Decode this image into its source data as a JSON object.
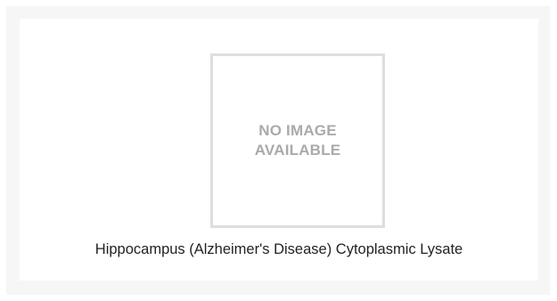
{
  "product": {
    "image_placeholder": {
      "line1": "NO IMAGE",
      "line2": "AVAILABLE"
    },
    "caption": "Hippocampus (Alzheimer's Disease) Cytoplasmic Lysate"
  }
}
